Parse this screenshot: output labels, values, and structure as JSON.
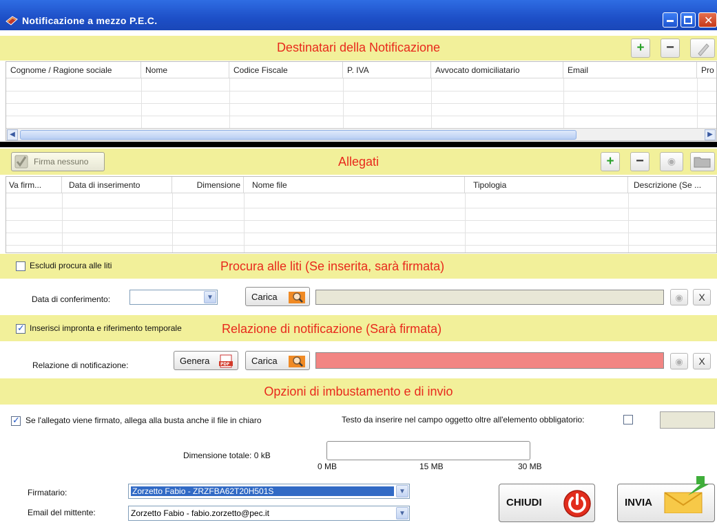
{
  "window": {
    "title": "Notificazione a mezzo P.E.C."
  },
  "recipients": {
    "title": "Destinatari della Notificazione",
    "columns": [
      "Cognome / Ragione sociale",
      "Nome",
      "Codice Fiscale",
      "P. IVA",
      "Avvocato domiciliatario",
      "Email",
      "Pro"
    ],
    "add_label": "+",
    "remove_label": "−"
  },
  "attachments": {
    "title": "Allegati",
    "sign_none_label": "Firma nessuno",
    "columns": [
      "Va firm...",
      "Data di inserimento",
      "Dimensione",
      "Nome file",
      "Tipologia",
      "Descrizione (Se ..."
    ],
    "add_label": "+",
    "remove_label": "−"
  },
  "procura": {
    "title": "Procura alle liti (Se inserita, sarà firmata)",
    "exclude_label": "Escludi procura alle liti",
    "exclude_checked": false,
    "date_label": "Data di conferimento:",
    "date_value": "",
    "load_label": "Carica",
    "clear_label": "X"
  },
  "relazione": {
    "title": "Relazione di notificazione (Sarà firmata)",
    "insert_label": "Inserisci impronta e riferimento temporale",
    "insert_checked": true,
    "field_label": "Relazione di notificazione:",
    "generate_label": "Genera",
    "load_label": "Carica",
    "clear_label": "X"
  },
  "options": {
    "title": "Opzioni di imbustamento e di invio",
    "attach_clear_label": "Se l'allegato viene firmato, allega alla busta anche il file in chiaro",
    "attach_clear_checked": true,
    "subject_label": "Testo da inserire nel campo oggetto oltre all'elemento obbligatorio:",
    "subject_checked": false,
    "total_size_label": "Dimensione totale: 0 kB",
    "size_ticks": [
      "0 MB",
      "15 MB",
      "30 MB"
    ],
    "size_progress": 0,
    "signer_label": "Firmatario:",
    "signer_value": "Zorzetto Fabio - ZRZFBA62T20H501S",
    "sender_label": "Email del mittente:",
    "sender_value": "Zorzetto Fabio - fabio.zorzetto@pec.it",
    "close_label": "CHIUDI",
    "send_label": "INVIA"
  }
}
